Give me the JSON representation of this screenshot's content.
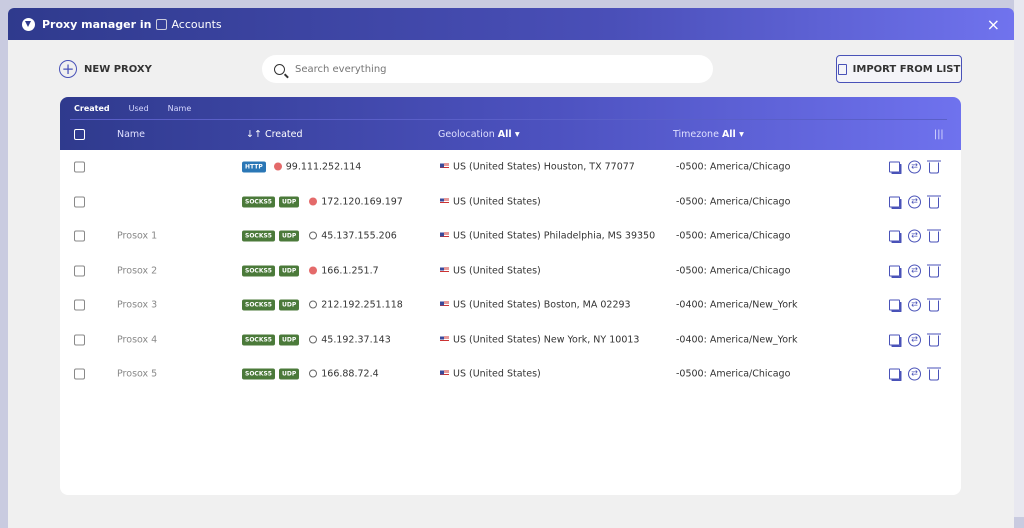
{
  "window": {
    "title": "Proxy manager in",
    "context": "Accounts",
    "close": "×"
  },
  "toolbar": {
    "new_proxy": "NEW PROXY",
    "search_placeholder": "Search everything",
    "import": "IMPORT FROM LIST"
  },
  "table": {
    "sort_tabs": [
      "Created",
      "Used",
      "Name"
    ],
    "columns": {
      "name": "Name",
      "created": "↓↑ Created",
      "geolocation": "Geolocation",
      "geo_filter": "All ▾",
      "timezone": "Timezone",
      "tz_filter": "All ▾",
      "columns_icon": "|||"
    },
    "rows": [
      {
        "name": "",
        "tags": [
          "HTTP"
        ],
        "status": "red",
        "ip": "99.111.252.114",
        "geo": "US (United States) Houston, TX 77077",
        "tz": "-0500: America/Chicago"
      },
      {
        "name": "",
        "tags": [
          "SOCKS5",
          "UDP"
        ],
        "status": "red",
        "ip": "172.120.169.197",
        "geo": "US (United States)",
        "tz": "-0500: America/Chicago"
      },
      {
        "name": "Prosox 1",
        "tags": [
          "SOCKS5",
          "UDP"
        ],
        "status": "off",
        "ip": "45.137.155.206",
        "geo": "US (United States) Philadelphia, MS 39350",
        "tz": "-0500: America/Chicago"
      },
      {
        "name": "Prosox 2",
        "tags": [
          "SOCKS5",
          "UDP"
        ],
        "status": "red",
        "ip": "166.1.251.7",
        "geo": "US (United States)",
        "tz": "-0500: America/Chicago"
      },
      {
        "name": "Prosox 3",
        "tags": [
          "SOCKS5",
          "UDP"
        ],
        "status": "off",
        "ip": "212.192.251.118",
        "geo": "US (United States) Boston, MA 02293",
        "tz": "-0400: America/New_York"
      },
      {
        "name": "Prosox 4",
        "tags": [
          "SOCKS5",
          "UDP"
        ],
        "status": "off",
        "ip": "45.192.37.143",
        "geo": "US (United States) New York, NY 10013",
        "tz": "-0400: America/New_York"
      },
      {
        "name": "Prosox 5",
        "tags": [
          "SOCKS5",
          "UDP"
        ],
        "status": "off",
        "ip": "166.88.72.4",
        "geo": "US (United States)",
        "tz": "-0500: America/Chicago"
      }
    ]
  },
  "colors": {
    "accent": "#4952b8",
    "header_start": "#2f3a8d",
    "header_end": "#6f72ee",
    "http": "#2a77b6",
    "socks": "#4b7a3a",
    "status_red": "#e46a6a"
  }
}
